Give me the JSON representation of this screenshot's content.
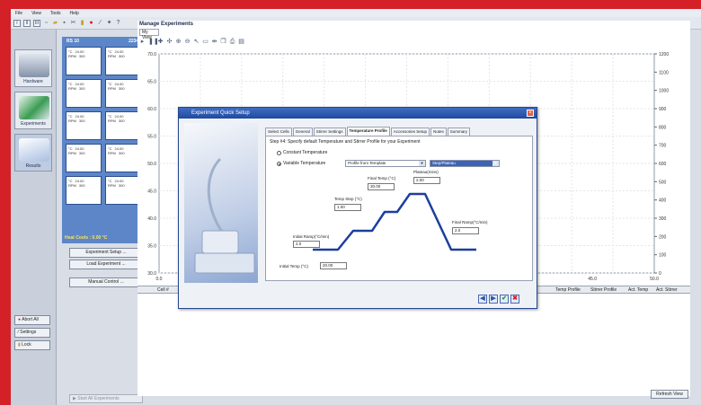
{
  "menu": [
    "File",
    "View",
    "Tools",
    "Help"
  ],
  "toolbar": {
    "buttons": [
      "I",
      "II",
      "III"
    ]
  },
  "sidebar": {
    "nav": [
      {
        "label": "Hardware",
        "icon": "hardware-icon"
      },
      {
        "label": "Experiments",
        "icon": "experiments-icon"
      },
      {
        "label": "Results",
        "icon": "results-icon"
      }
    ],
    "abort_all": "Abort All",
    "settings": "Settings",
    "lock": "Lock"
  },
  "reactor": {
    "title_left": "RS 10",
    "title_right": "22345",
    "temp_unit": "°C",
    "temp_value": "24.00",
    "rpm_label": "RPM",
    "rpm_value": "300",
    "heat_cool": "Heat Cools : 0.00 °C"
  },
  "mid_buttons": {
    "setup": "Experiment Setup ...",
    "load": "Load Experiment ...",
    "manual": "Manual Control ...",
    "start_all": "Start All Experiments"
  },
  "main": {
    "title": "Manage Experiments",
    "tab": "My View",
    "refresh": "Refresh View"
  },
  "chart_data": {
    "type": "line",
    "series": [],
    "y_left": {
      "ticks": [
        "70.0",
        "65.0",
        "60.0",
        "55.0",
        "50.0",
        "45.0",
        "40.0",
        "35.0",
        "30.0"
      ],
      "range": [
        30,
        70
      ]
    },
    "y_right": {
      "ticks": [
        "1200",
        "1100",
        "1000",
        "900",
        "800",
        "700",
        "600",
        "500",
        "400",
        "300",
        "200",
        "100",
        "0"
      ],
      "range": [
        0,
        1200
      ]
    },
    "x": {
      "ticks": [
        "0.0",
        "40.0",
        "45.0",
        "50.0"
      ]
    },
    "grid": true
  },
  "grid": {
    "columns": [
      {
        "label": "Cell #"
      },
      {
        "label": "Temp Profile"
      },
      {
        "label": "Stirrer Profile"
      },
      {
        "label": "Act. Temp"
      },
      {
        "label": "Act. Stirrer"
      }
    ]
  },
  "dialog": {
    "title": "Experiment Quick Setup",
    "tabs": [
      "Select Cells",
      "General",
      "Stirrer Settings",
      "Temperature Profile",
      "Accessories Setup",
      "Notes",
      "Summary"
    ],
    "active_tab": "Temperature Profile",
    "step": "Step #4: Specify default Temperature and Stirrer Profile for your Experiment",
    "radio_constant": "Constant Temperature",
    "radio_variable": "Variable Temperature",
    "variable_selected": true,
    "select_profile": "Profile from Template",
    "select_step": "Step/Plateau",
    "profile": {
      "initial_temp_label": "Initial Temp (°C)",
      "initial_temp": "20.00",
      "initial_ramp_label": "Initial Ramp(°C/min)",
      "initial_ramp": "2.0",
      "temp_step_label": "Temp Step (°C)",
      "temp_step": "1.00",
      "final_temp_label": "Final Temp (°C)",
      "final_temp": "30.00",
      "plateau_label": "Plateau(mins)",
      "plateau": "2.00",
      "final_ramp_label": "Final Ramp(°C/min)",
      "final_ramp": "2.0"
    },
    "profile_color": "#1c3f9e"
  }
}
